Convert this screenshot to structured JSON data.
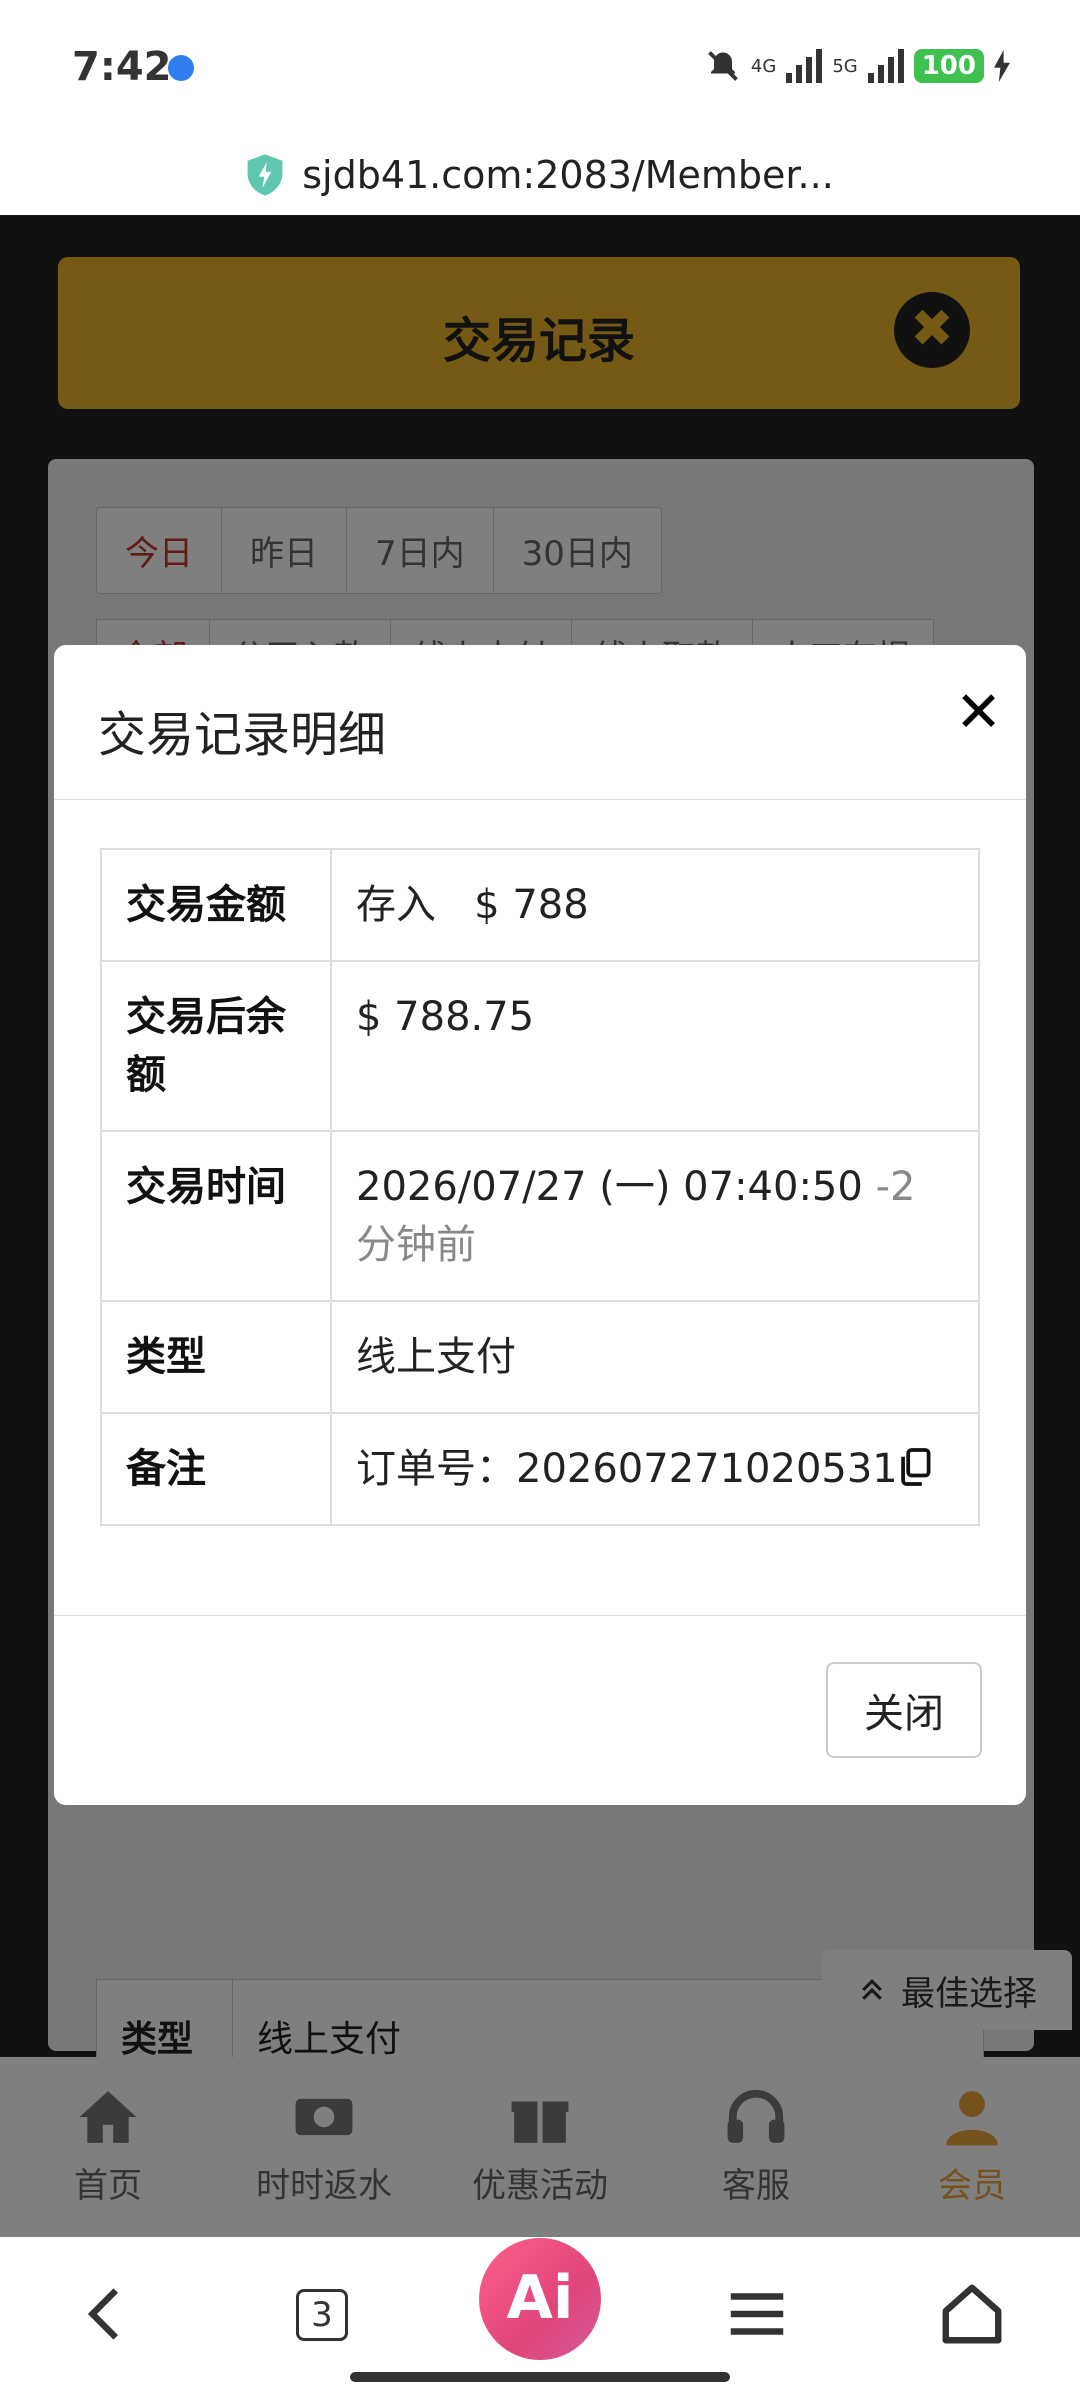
{
  "status_bar": {
    "time": "7:42",
    "network1": "4G",
    "network2": "5G",
    "battery": "100"
  },
  "url_bar": {
    "url": "sjdb41.com:2083/Member..."
  },
  "page": {
    "header_title": "交易记录",
    "date_tabs": [
      "今日",
      "昨日",
      "7日内",
      "30日内"
    ],
    "type_tabs": [
      "全部",
      "公司入款",
      "线上支付",
      "线上取款",
      "人工存提"
    ],
    "bg_row": {
      "label": "类型",
      "value": "线上支付"
    },
    "best_choice": "最佳选择",
    "nav": [
      "首页",
      "时时返水",
      "优惠活动",
      "客服",
      "会员"
    ]
  },
  "modal": {
    "title": "交易记录明细",
    "rows": {
      "amount": {
        "label": "交易金额",
        "type": "存入",
        "value": "$ 788"
      },
      "balance": {
        "label": "交易后余额",
        "value": "$ 788.75"
      },
      "time": {
        "label": "交易时间",
        "value": "2026/07/27 (一) 07:40:50",
        "relative": "-2 分钟前"
      },
      "category": {
        "label": "类型",
        "value": "线上支付"
      },
      "note": {
        "label": "备注",
        "value": "订单号：202607271020531"
      }
    },
    "close_button": "关闭"
  },
  "browser_bar": {
    "tab_count": "3",
    "ai_label": "Ai"
  }
}
